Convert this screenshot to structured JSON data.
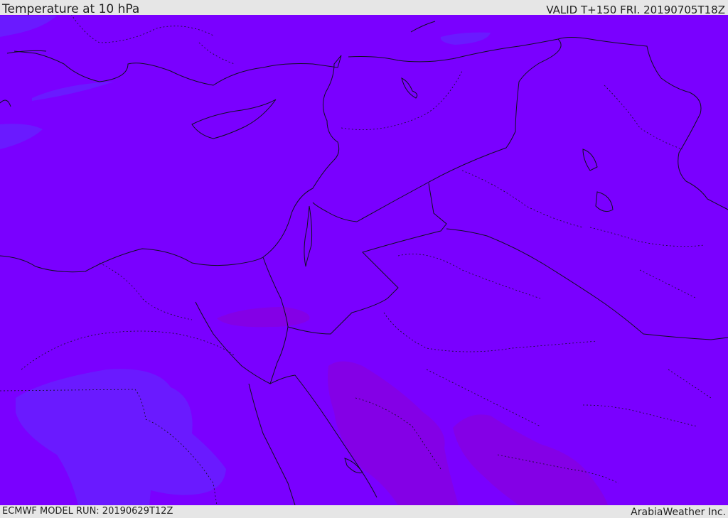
{
  "header": {
    "title": "Temperature at 10 hPa",
    "valid": "VALID T+150 FRI. 20190705T18Z"
  },
  "footer": {
    "model_run": "ECMWF MODEL RUN: 20190629T12Z",
    "credit": "ArabiaWeather Inc."
  },
  "colors": {
    "base_field": "#7a00ff",
    "cooler_field": "#6a1aff",
    "cooler_light": "#5b33ff",
    "warmer_field": "#8400e6",
    "border": "#101020"
  }
}
